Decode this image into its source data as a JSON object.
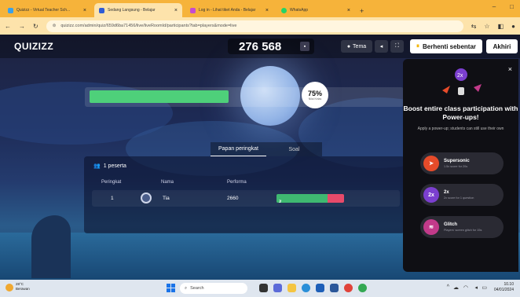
{
  "browser": {
    "tabs": [
      {
        "label": "Quizizz - Virtual Teacher Sch...",
        "color": "#3aa0e8",
        "active": false
      },
      {
        "label": "Sedang Langsung - Belajar",
        "color": "#2f5cd6",
        "active": true
      },
      {
        "label": "Log in - Lihat tiket Anda - Belajar",
        "color": "#c44ccf",
        "active": false
      },
      {
        "label": "WhatsApp",
        "color": "#25d366",
        "active": false
      }
    ],
    "new_tab": "+",
    "url": "quizizz.com/admin/quiz/659d6ba71456/live/liveRoomId/participants?tab=players&mode=live",
    "window_controls": [
      "–",
      "□"
    ]
  },
  "app": {
    "logo": "QUIZIZZ",
    "game_code": "276 568",
    "theme_label": "Tema",
    "pause_label": "Berhenti sebentar",
    "end_label": "Akhiri",
    "progress": {
      "percent_text": "75%",
      "sub_text": "Nilai Kelas",
      "fill_fraction": 0.45
    },
    "tabs": [
      "Papan peringkat",
      "Soal"
    ],
    "participants_label": "1 peserta",
    "table": {
      "headers": [
        "Peringkat",
        "Nama",
        "Performa"
      ],
      "rows": [
        {
          "rank": "1",
          "name": "Tia",
          "score": "2660",
          "correct": "3",
          "correct_fraction": 0.75,
          "wrong_fraction": 0.25
        }
      ]
    }
  },
  "powerups": {
    "close": "×",
    "title": "Boost entire class participation with Power-ups!",
    "subtitle": "Apply a power-up; students can still use their own",
    "items": [
      {
        "name": "Supersonic",
        "desc": "1.5x score for 20s",
        "color": "#e64b2a",
        "icon": "rocket-icon"
      },
      {
        "name": "2x",
        "desc": "2x score for 1 question",
        "color": "#7b3fcf",
        "icon": "2x-icon",
        "glyph": "2x"
      },
      {
        "name": "Glitch",
        "desc": "Players' screen glitch for 15s",
        "color": "#c23a8a",
        "icon": "glitch-icon"
      }
    ]
  },
  "taskbar": {
    "temp": "28°C",
    "weather": "Berawan",
    "search": "Search",
    "time": "10.10",
    "date": "04/01/2024"
  }
}
